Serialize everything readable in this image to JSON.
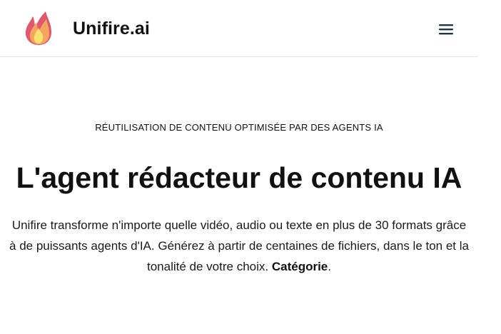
{
  "header": {
    "brand_name": "Unifire.ai",
    "logo_icon": "flame-logo-icon",
    "menu_icon": "hamburger-menu-icon"
  },
  "hero": {
    "eyebrow": "RÉUTILISATION DE CONTENU OPTIMISÉE PAR DES AGENTS IA",
    "headline": "L'agent rédacteur de contenu IA",
    "lead_text": "Unifire transforme n'importe quelle vidéo, audio ou texte en plus de 30 formats grâce à de puissants agents d'IA. Générez à partir de centaines de fichiers, dans le ton et la tonalité de votre choix.",
    "lead_highlight": "Catégorie",
    "lead_end": "."
  },
  "colors": {
    "text": "#111111",
    "border": "#e7e7e7",
    "flame_red": "#e35670",
    "flame_orange": "#f6a55d",
    "flame_yellow": "#fbe16d",
    "menu_icon": "#17364a"
  }
}
